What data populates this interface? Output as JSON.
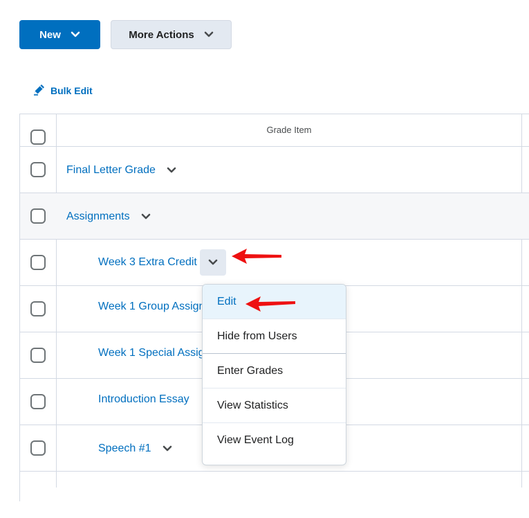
{
  "toolbar": {
    "new_label": "New",
    "more_actions_label": "More Actions",
    "bulk_edit_label": "Bulk Edit"
  },
  "table": {
    "header": "Grade Item",
    "rows": [
      {
        "name": "Final Letter Grade"
      },
      {
        "name": "Assignments"
      },
      {
        "name": "Week 3 Extra Credit"
      },
      {
        "name": "Week 1 Group Assignment"
      },
      {
        "name": "Week 1 Special Assignment"
      },
      {
        "name": "Introduction Essay"
      },
      {
        "name": "Speech #1"
      }
    ]
  },
  "context_menu": {
    "items": [
      "Edit",
      "Hide from Users",
      "Enter Grades",
      "View Statistics",
      "View Event Log"
    ]
  },
  "icons": {
    "bulk_edit": "pencil-icon",
    "dropdown": "chevron-down-icon",
    "annotation": "red-arrow-icon"
  },
  "colors": {
    "primary": "#006fbf",
    "secondary_button": "#e3e9f1",
    "annotation_arrow": "#ee1111"
  }
}
